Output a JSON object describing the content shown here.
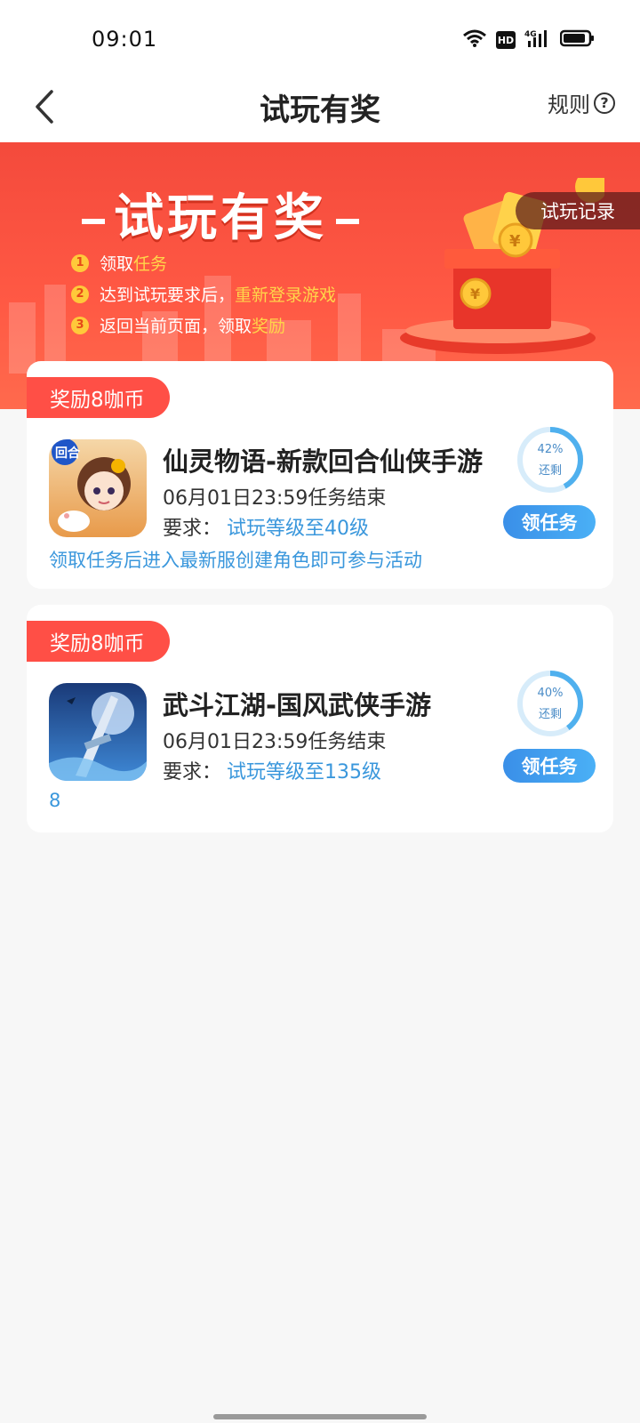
{
  "status_bar": {
    "time": "09:01",
    "hd_label": "HD",
    "network_label": "4G"
  },
  "header": {
    "title": "试玩有奖",
    "rules_label": "规则"
  },
  "banner": {
    "title": "试玩有奖",
    "record_label": "试玩记录",
    "steps": [
      {
        "num": "1",
        "text": "领取",
        "highlight": "任务"
      },
      {
        "num": "2",
        "text": "达到试玩要求后，",
        "highlight": "重新登录游戏"
      },
      {
        "num": "3",
        "text": "返回当前页面，领取",
        "highlight": "奖励"
      }
    ]
  },
  "tasks": [
    {
      "reward": "奖励8咖币",
      "name": "仙灵物语-新款回合仙侠手游",
      "deadline": "06月01日23:59任务结束",
      "require_label": "要求：",
      "require_value": "试玩等级至40级",
      "note": "领取任务后进入最新服创建角色即可参与活动",
      "percent_label": "42%",
      "percent": 42,
      "remain_label": "还剩",
      "button": "领任务"
    },
    {
      "reward": "奖励8咖币",
      "name": "武斗江湖-国风武侠手游",
      "deadline": "06月01日23:59任务结束",
      "require_label": "要求：",
      "require_value": "试玩等级至135级",
      "note": "8",
      "percent_label": "40%",
      "percent": 40,
      "remain_label": "还剩",
      "button": "领任务"
    }
  ],
  "colors": {
    "accent": "#ff4f46",
    "link": "#3a97dc",
    "button": "#3a8fe8"
  },
  "icons": [
    "back-arrow-icon",
    "help-icon",
    "wifi-icon",
    "hd-icon",
    "signal-icon",
    "battery-icon"
  ]
}
